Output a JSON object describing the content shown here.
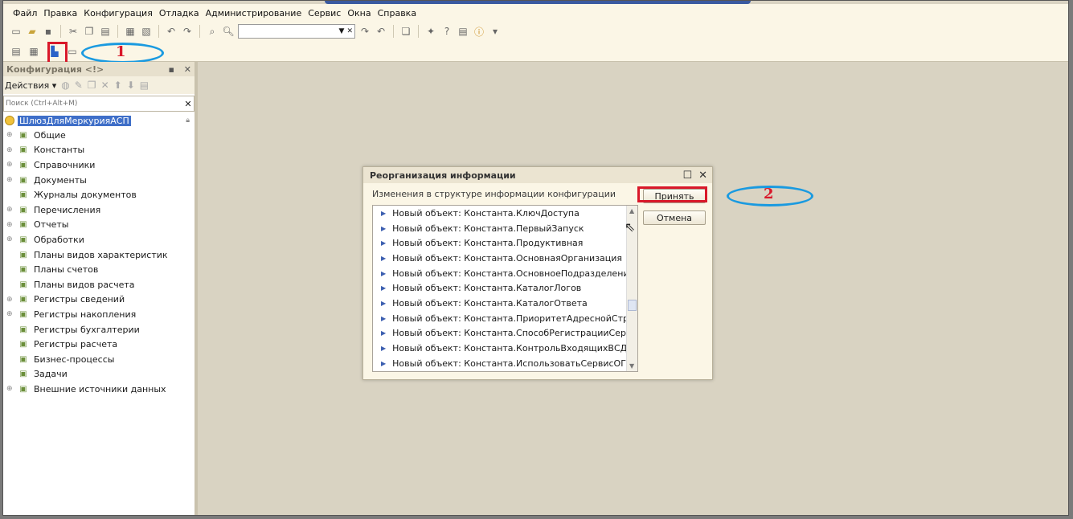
{
  "menu": [
    "Файл",
    "Правка",
    "Конфигурация",
    "Отладка",
    "Администрирование",
    "Сервис",
    "Окна",
    "Справка"
  ],
  "toolbar": {
    "search_value": ""
  },
  "annotations": {
    "marker1": "1",
    "marker2": "2"
  },
  "config_panel": {
    "title": "Конфигурация <!>",
    "actions_label": "Действия",
    "search_placeholder": "Поиск (Ctrl+Alt+M)",
    "root": "ШлюзДляМеркурияАСП",
    "items": [
      {
        "label": "Общие",
        "icon": "common-icon",
        "expandable": true
      },
      {
        "label": "Константы",
        "icon": "constants-icon",
        "expandable": true
      },
      {
        "label": "Справочники",
        "icon": "catalogs-icon",
        "expandable": true
      },
      {
        "label": "Документы",
        "icon": "documents-icon",
        "expandable": true
      },
      {
        "label": "Журналы документов",
        "icon": "journals-icon",
        "expandable": false
      },
      {
        "label": "Перечисления",
        "icon": "enums-icon",
        "expandable": true
      },
      {
        "label": "Отчеты",
        "icon": "reports-icon",
        "expandable": true
      },
      {
        "label": "Обработки",
        "icon": "processing-icon",
        "expandable": true
      },
      {
        "label": "Планы видов характеристик",
        "icon": "chart-of-characteristics-icon",
        "expandable": false
      },
      {
        "label": "Планы счетов",
        "icon": "chart-of-accounts-icon",
        "expandable": false
      },
      {
        "label": "Планы видов расчета",
        "icon": "chart-of-calc-icon",
        "expandable": false
      },
      {
        "label": "Регистры сведений",
        "icon": "info-registers-icon",
        "expandable": true
      },
      {
        "label": "Регистры накопления",
        "icon": "accum-registers-icon",
        "expandable": true
      },
      {
        "label": "Регистры бухгалтерии",
        "icon": "accounting-registers-icon",
        "expandable": false
      },
      {
        "label": "Регистры расчета",
        "icon": "calc-registers-icon",
        "expandable": false
      },
      {
        "label": "Бизнес-процессы",
        "icon": "business-process-icon",
        "expandable": false
      },
      {
        "label": "Задачи",
        "icon": "tasks-icon",
        "expandable": false
      },
      {
        "label": "Внешние источники данных",
        "icon": "external-sources-icon",
        "expandable": true
      }
    ]
  },
  "dialog": {
    "title": "Реорганизация информации",
    "subtitle": "Изменения в структуре информации конфигурации",
    "accept_label": "Принять",
    "cancel_label": "Отмена",
    "changes": [
      "Новый объект: Константа.КлючДоступа",
      "Новый объект: Константа.ПервыйЗапуск",
      "Новый объект: Константа.Продуктивная",
      "Новый объект: Константа.ОсновнаяОрганизация",
      "Новый объект: Константа.ОсновноеПодразделение",
      "Новый объект: Константа.КаталогЛогов",
      "Новый объект: Константа.КаталогОтвета",
      "Новый объект: Константа.ПриоритетАдреснойСтроки",
      "Новый объект: Константа.СпособРегистрацииСертифи...",
      "Новый объект: Константа.КонтрольВходящихВСД",
      "Новый объект: Константа.ИспользоватьСервисОГРН"
    ]
  }
}
